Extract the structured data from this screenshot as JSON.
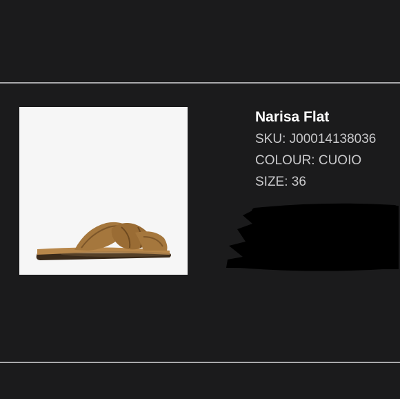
{
  "product": {
    "name": "Narisa Flat",
    "sku": "SKU: J00014138036",
    "colour": "COLOUR: CUOIO",
    "size": "SIZE: 36"
  },
  "image": {
    "icon": "sandal-product-photo",
    "background": "#f6f6f6",
    "sandal_color": "#a5773d"
  },
  "colors": {
    "background": "#1b1b1c",
    "divider": "#a9a9ab",
    "title": "#ffffff",
    "detail_text": "#c9c9cb",
    "redaction": "#000000"
  }
}
